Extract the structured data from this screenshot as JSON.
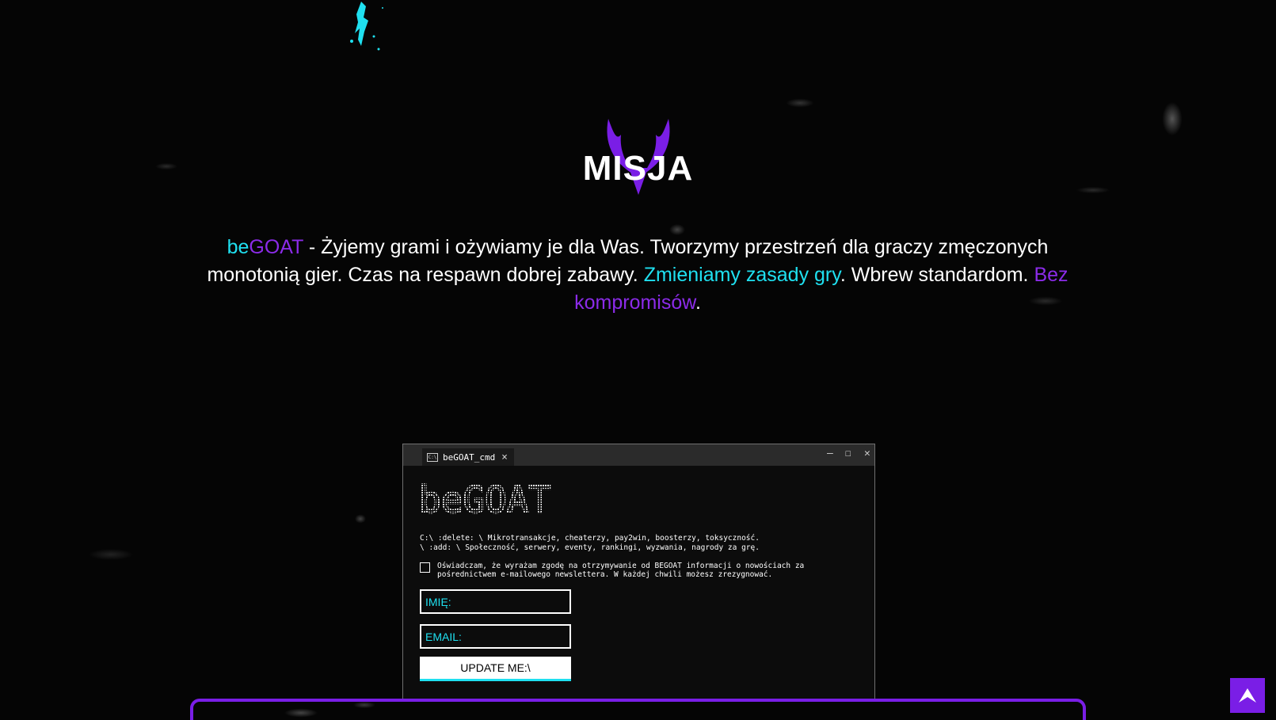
{
  "mission": {
    "title": "MISJA",
    "brand_be": "be",
    "brand_goat": "GOAT",
    "text_1": " - Żyjemy grami i ożywiamy je dla Was. Tworzymy przestrzeń dla graczy zmęczonych monotonią gier. Czas na respawn dobrej zabawy. ",
    "highlight_1": "Zmieniamy zasady gry",
    "text_2": ". Wbrew standardom. ",
    "highlight_2": "Bez kompromisów",
    "text_3": "."
  },
  "cmd": {
    "tab_label": "beGOAT_cmd",
    "tab_icon": "C:\\",
    "logo_text": "beGOAT",
    "line_delete": "C:\\ :delete: \\ Mikrotransakcje, cheaterzy, pay2win, boosterzy, toksyczność.",
    "line_add": "\\ :add: \\ Społeczność, serwery, eventy, rankingi, wyzwania, nagrody za grę.",
    "consent": "Oświadczam, że wyrażam zgodę na otrzymywanie od BEGOAT informacji o nowościach za pośrednictwem e-mailowego newslettera. W każdej chwili możesz zrezygnować.",
    "name_placeholder": "IMIĘ:",
    "email_placeholder": "EMAIL:",
    "submit_label": "UPDATE ME:\\",
    "window_minimize": "–",
    "window_maximize": "☐",
    "window_close": "✕"
  },
  "icons": {
    "logo": "goat-horns-icon",
    "scroll_top": "arrow-up-icon"
  },
  "colors": {
    "accent_cyan": "#1fe0f0",
    "accent_purple": "#7a1ee6",
    "background": "#050505"
  }
}
